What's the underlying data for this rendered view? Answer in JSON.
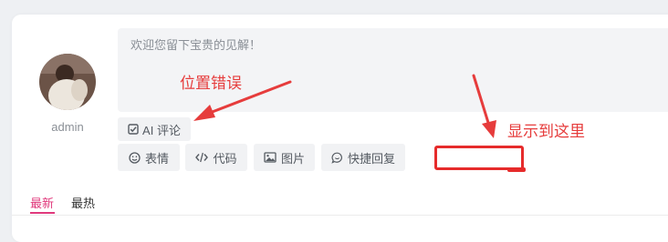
{
  "comment": {
    "avatar_icon": "user-avatar-photo",
    "username": "admin",
    "placeholder": "欢迎您留下宝贵的见解！",
    "ai_button": {
      "icon": "check-square-icon",
      "label": "AI 评论"
    },
    "toolbar": [
      {
        "icon": "smile-icon",
        "label": "表情"
      },
      {
        "icon": "code-icon",
        "label": "代码"
      },
      {
        "icon": "image-icon",
        "label": "图片"
      },
      {
        "icon": "chat-bubble-icon",
        "label": "快捷回复"
      }
    ]
  },
  "annotations": {
    "wrong_position": "位置错误",
    "show_here": "显示到这里",
    "color": "#e63c3c"
  },
  "tabs": [
    {
      "label": "最新",
      "active": true
    },
    {
      "label": "最热",
      "active": false
    }
  ],
  "accent_color": "#e0397c"
}
